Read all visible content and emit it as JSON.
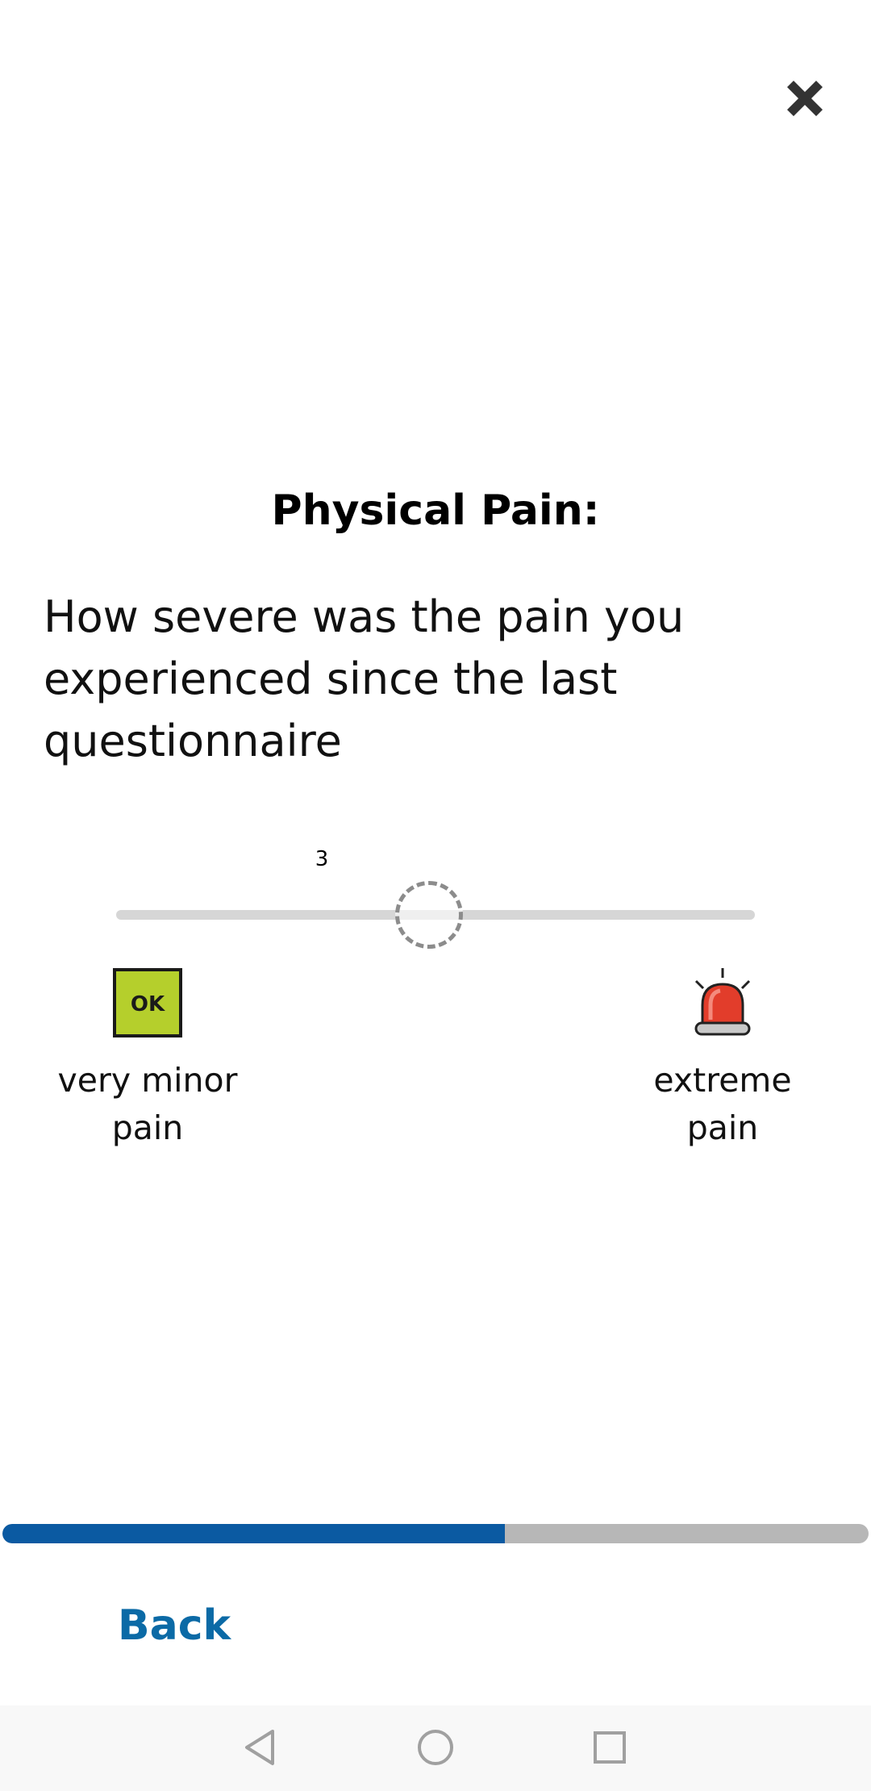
{
  "header": {
    "close_icon": "close-icon"
  },
  "question": {
    "title": "Physical Pain:",
    "text": "How severe was the pain you experienced since the last questionnaire"
  },
  "slider": {
    "value": 3,
    "value_label": "3",
    "min": 0,
    "max": 7,
    "position_fraction": 0.49
  },
  "anchors": {
    "left": {
      "icon": "ok-icon",
      "label_line1": "very minor",
      "label_line2": "pain"
    },
    "right": {
      "icon": "alarm-siren-icon",
      "label_line1": "extreme",
      "label_line2": "pain"
    }
  },
  "progress": {
    "fraction": 0.58,
    "fill_color": "#0b5aa2",
    "track_color": "#b7b7b7"
  },
  "footer": {
    "back_label": "Back",
    "back_color": "#0b6aa6"
  },
  "navbar": {
    "back_icon": "nav-back-triangle-icon",
    "home_icon": "nav-home-circle-icon",
    "recents_icon": "nav-recents-square-icon"
  }
}
